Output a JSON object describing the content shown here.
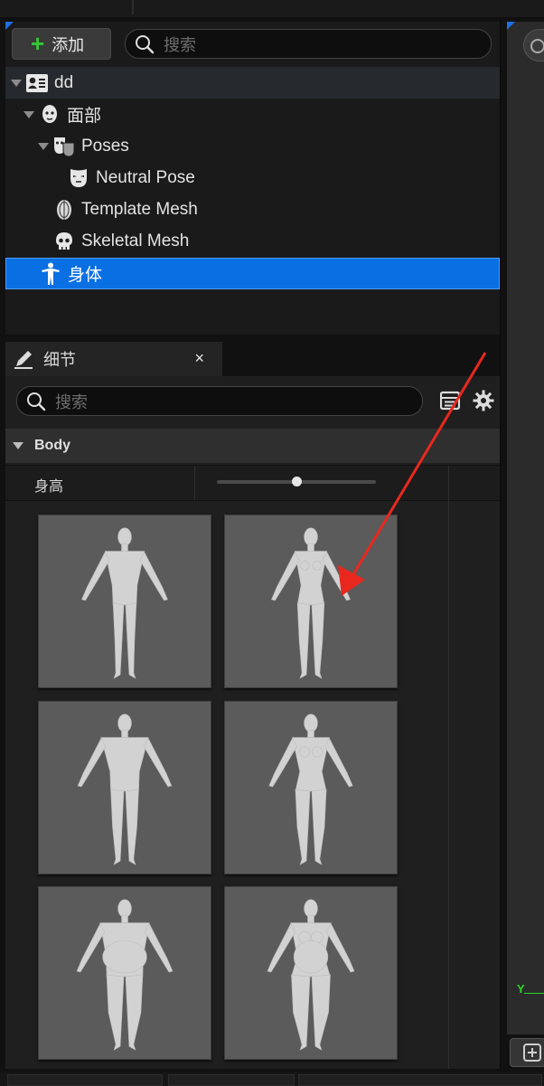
{
  "outliner": {
    "add_label": "添加",
    "search_placeholder": "搜索",
    "tree": [
      {
        "label": "dd",
        "icon": "character-card-icon",
        "expanded": true
      },
      {
        "label": "面部",
        "icon": "face-head-icon",
        "expanded": true
      },
      {
        "label": "Poses",
        "icon": "theater-masks-icon",
        "expanded": true
      },
      {
        "label": "Neutral Pose",
        "icon": "mask-icon"
      },
      {
        "label": "Template Mesh",
        "icon": "head-mesh-icon"
      },
      {
        "label": "Skeletal Mesh",
        "icon": "skull-icon"
      },
      {
        "label": "身体",
        "icon": "body-figure-icon",
        "selected": true
      }
    ]
  },
  "details": {
    "tab_label": "细节",
    "close_glyph": "×",
    "search_placeholder": "搜索",
    "section_title": "Body",
    "height_label": "身高",
    "height_value": 0.5,
    "presets": [
      {
        "id": "male-average"
      },
      {
        "id": "female-average"
      },
      {
        "id": "male-athletic"
      },
      {
        "id": "female-athletic"
      },
      {
        "id": "male-heavy"
      },
      {
        "id": "female-heavy"
      }
    ]
  },
  "viewport": {
    "axis_label": "Y"
  },
  "colors": {
    "selection": "#0a6fe3",
    "accent_green": "#35c635",
    "annotation": "#e8281e"
  }
}
